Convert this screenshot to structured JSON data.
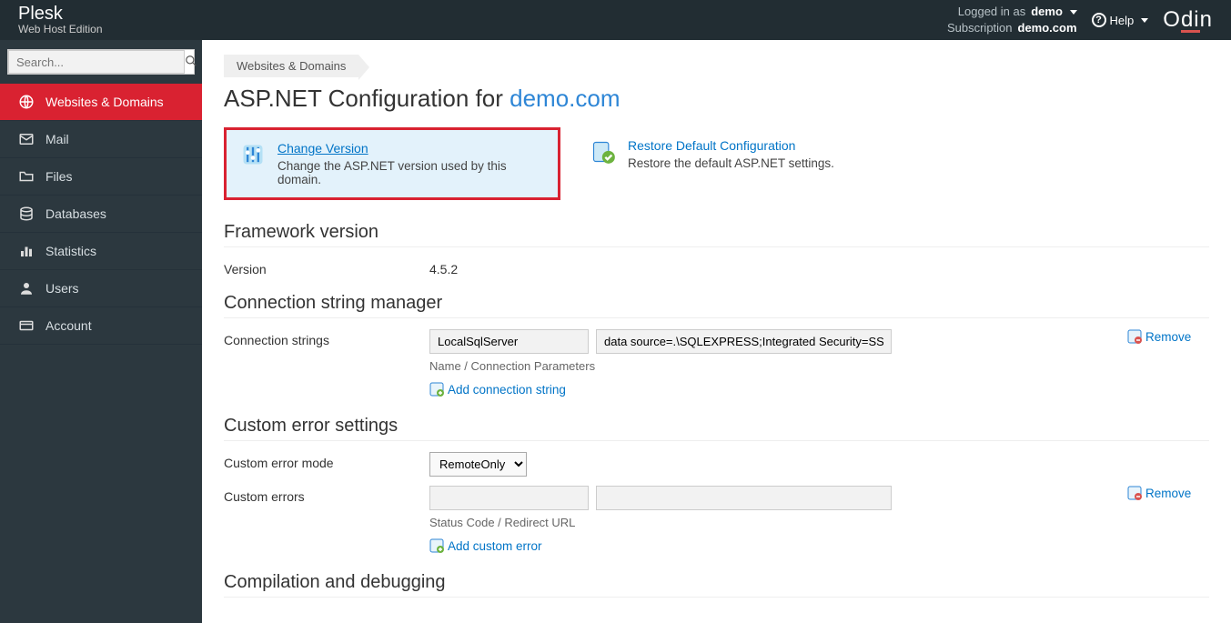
{
  "topbar": {
    "brand_title": "Plesk",
    "brand_subtitle": "Web Host Edition",
    "logged_in_label": "Logged in as",
    "logged_in_value": "demo",
    "subscription_label": "Subscription",
    "subscription_value": "demo.com",
    "help_label": "Help",
    "partner": "Odin"
  },
  "sidebar": {
    "search_placeholder": "Search...",
    "items": [
      {
        "label": "Websites & Domains"
      },
      {
        "label": "Mail"
      },
      {
        "label": "Files"
      },
      {
        "label": "Databases"
      },
      {
        "label": "Statistics"
      },
      {
        "label": "Users"
      },
      {
        "label": "Account"
      }
    ]
  },
  "breadcrumb": {
    "item": "Websites & Domains"
  },
  "page": {
    "title_prefix": "ASP.NET Configuration for ",
    "domain": "demo.com"
  },
  "tiles": {
    "change_version": {
      "title": "Change Version",
      "desc": "Change the ASP.NET version used by this domain."
    },
    "restore_default": {
      "title": "Restore Default Configuration",
      "desc": "Restore the default ASP.NET settings."
    }
  },
  "framework": {
    "heading": "Framework version",
    "version_label": "Version",
    "version_value": "4.5.2"
  },
  "conn": {
    "heading": "Connection string manager",
    "label": "Connection strings",
    "name_value": "LocalSqlServer",
    "params_value": "data source=.\\SQLEXPRESS;Integrated Security=SSP",
    "help": "Name / Connection Parameters",
    "add_link": "Add connection string",
    "remove": "Remove"
  },
  "errors": {
    "heading": "Custom error settings",
    "mode_label": "Custom error mode",
    "mode_value": "RemoteOnly",
    "list_label": "Custom errors",
    "status_value": "",
    "url_value": "",
    "help": "Status Code / Redirect URL",
    "add_link": "Add custom error",
    "remove": "Remove"
  },
  "compile": {
    "heading": "Compilation and debugging"
  }
}
